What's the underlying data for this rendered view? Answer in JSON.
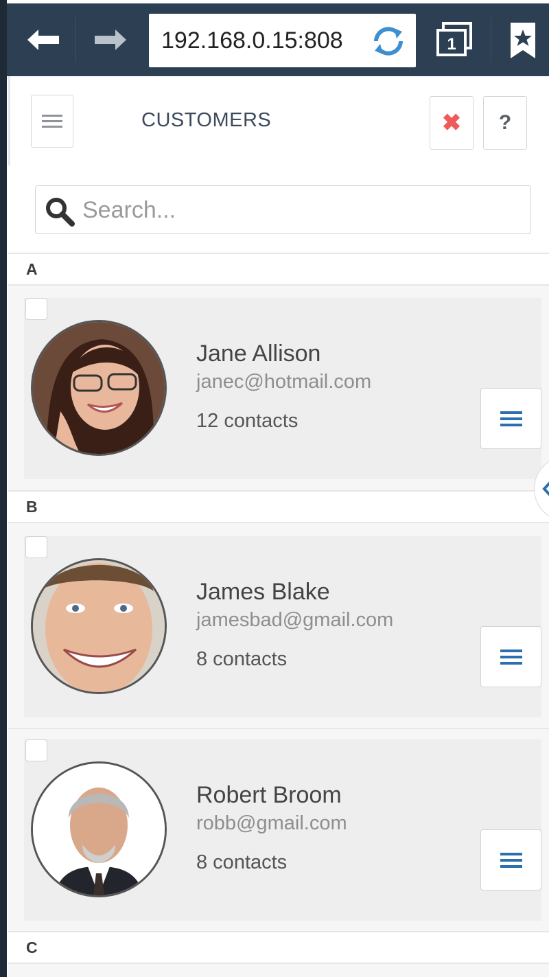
{
  "browser": {
    "url": "192.168.0.15:808",
    "tab_count": "1",
    "icons": [
      "back-arrow-icon",
      "forward-arrow-icon",
      "reload-icon",
      "tabs-icon",
      "bookmark-star-icon"
    ]
  },
  "header": {
    "title": "CUSTOMERS",
    "close_label": "✖",
    "help_label": "?"
  },
  "search": {
    "placeholder": "Search..."
  },
  "sections": [
    {
      "letter": "A"
    },
    {
      "letter": "B"
    },
    {
      "letter": "C"
    }
  ],
  "customers": [
    {
      "name": "Jane Allison",
      "email": "janec@hotmail.com",
      "contacts": "12 contacts"
    },
    {
      "name": "James Blake",
      "email": "jamesbad@gmail.com",
      "contacts": "8 contacts"
    },
    {
      "name": "Robert Broom",
      "email": "robb@gmail.com",
      "contacts": "8 contacts"
    }
  ],
  "colors": {
    "toolbar": "#2c3f53",
    "accent_blue": "#2b6fb0",
    "close_red": "#ef5b5b",
    "card_bg": "#eeeeee"
  }
}
